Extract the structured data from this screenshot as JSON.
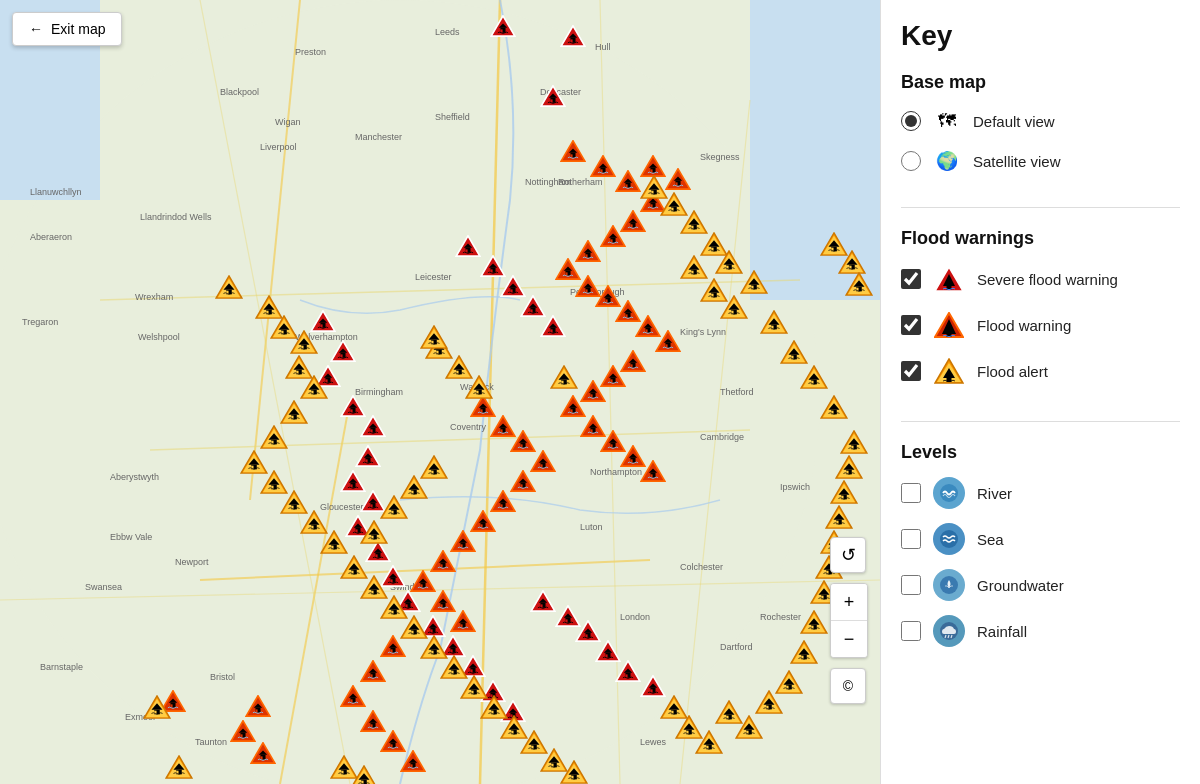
{
  "exit_button": {
    "label": "Exit map",
    "arrow": "←"
  },
  "sidebar": {
    "title": "Key",
    "base_map": {
      "heading": "Base map",
      "options": [
        {
          "id": "default-view",
          "label": "Default view",
          "icon": "🗺",
          "checked": true
        },
        {
          "id": "satellite-view",
          "label": "Satellite view",
          "icon": "🌍",
          "checked": false
        }
      ]
    },
    "flood_warnings": {
      "heading": "Flood warnings",
      "options": [
        {
          "id": "severe-flood",
          "label": "Severe flood warning",
          "type": "severe",
          "checked": true
        },
        {
          "id": "flood-warning",
          "label": "Flood warning",
          "type": "warning",
          "checked": true
        },
        {
          "id": "flood-alert",
          "label": "Flood alert",
          "type": "alert",
          "checked": true
        }
      ]
    },
    "levels": {
      "heading": "Levels",
      "options": [
        {
          "id": "river",
          "label": "River",
          "icon": "💧",
          "class": "level-icon-river",
          "checked": false
        },
        {
          "id": "sea",
          "label": "Sea",
          "icon": "〰",
          "class": "level-icon-sea",
          "checked": false
        },
        {
          "id": "groundwater",
          "label": "Groundwater",
          "icon": "💧",
          "class": "level-icon-groundwater",
          "checked": false
        },
        {
          "id": "rainfall",
          "label": "Rainfall",
          "icon": "🌧",
          "class": "level-icon-rainfall",
          "checked": false
        }
      ]
    }
  },
  "map_controls": {
    "reset": "↺",
    "zoom_in": "+",
    "zoom_out": "−",
    "copyright": "©"
  },
  "colors": {
    "severe": "#cc0000",
    "warning": "#e03000",
    "alert": "#ff8800",
    "accent": "#1a73e8"
  }
}
